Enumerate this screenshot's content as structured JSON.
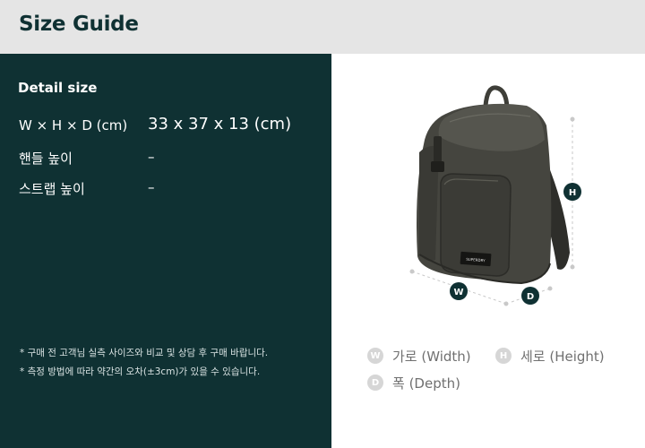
{
  "header": {
    "title": "Size Guide"
  },
  "detail": {
    "title": "Detail size",
    "rows": [
      {
        "label": "W × H × D (cm)",
        "value": "33 x 37 x 13 (cm)"
      },
      {
        "label": "핸들 높이",
        "value": "–"
      },
      {
        "label": "스트랩 높이",
        "value": "–"
      }
    ],
    "notes": [
      "* 구매 전 고객님 실측 사이즈와 비교 및 상담 후 구매 바랍니다.",
      "* 측정 방법에 따라 약간의 오차(±3cm)가 있을 수 있습니다."
    ]
  },
  "diagram": {
    "label_brand": "SUPERDRY",
    "markers": {
      "width": "W",
      "height": "H",
      "depth": "D"
    }
  },
  "legend": {
    "items": [
      {
        "badge": "W",
        "label": "가로 (Width)"
      },
      {
        "badge": "H",
        "label": "세로 (Height)"
      },
      {
        "badge": "D",
        "label": "폭 (Depth)"
      }
    ]
  },
  "colors": {
    "header_bg": "#e5e5e5",
    "panel_bg": "#0f3133",
    "accent": "#0f3133",
    "muted": "#d6d6d6"
  }
}
